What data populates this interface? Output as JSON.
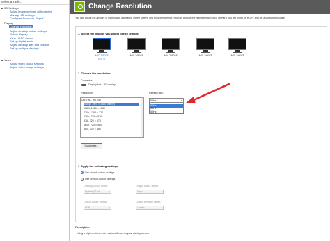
{
  "left_pane": {
    "title": "Select a Task...",
    "groups": [
      {
        "name": "3D Settings",
        "items": [
          "Adjust image settings with preview",
          "Manage 3D settings",
          "Configure Surround, PhysX"
        ]
      },
      {
        "name": "Display",
        "items": [
          "Change resolution",
          "Adjust desktop colour settings",
          "Rotate display",
          "View HDCP status",
          "Set up digital audio",
          "Adjust desktop size and position",
          "Set up multiple displays"
        ]
      },
      {
        "name": "Video",
        "items": [
          "Adjust video colour settings",
          "Adjust video image settings"
        ]
      }
    ],
    "selected_item": "Change resolution"
  },
  "header": {
    "title": "Change Resolution"
  },
  "description": "You can adjust the amount of information appearing on the screen and reduce flickering. You can choose the high definition (HD) format if you are using an HDTV and set a custom resolution.",
  "section1": {
    "title": "1. Select the display you would like to change.",
    "displays": [
      {
        "name": "AOC 2460G5",
        "index": "(1 of 4)",
        "active": true
      },
      {
        "name": "AOC 2460G5",
        "index": "",
        "active": false
      },
      {
        "name": "AOC 2460G5",
        "index": "",
        "active": false
      },
      {
        "name": "AOC 2460G5",
        "index": "",
        "active": false
      },
      {
        "name": "AOC 2460G5",
        "index": "",
        "active": false
      }
    ]
  },
  "section2": {
    "title": "2. Choose the resolution.",
    "connector_label": "Connector:",
    "connector_value": "DisplayPort - PC display",
    "resolution_label": "Resolution:",
    "refresh_label": "Refresh rate:",
    "resolution_category": "Ultra HD, HD, SD",
    "resolutions": [
      "1080p, 1920 × 1080 (native)",
      "1080i, 1920 × 1080",
      "720p, 1280 × 720",
      "576p, 720 × 576",
      "576i, 720 × 576",
      "480p, 720 × 480",
      "480i, 720 × 480"
    ],
    "selected_resolution_index": 0,
    "refresh_selected": "60Hz",
    "refresh_options": [
      "60Hz",
      "59Hz",
      "50Hz"
    ],
    "customize_label": "Customise..."
  },
  "section3": {
    "title": "3. Apply the following settings.",
    "radio_default": "Use default colour settings",
    "radio_nvidia": "Use NVIDIA colour settings",
    "desktop_colour_depth_label": "Desktop colour depth:",
    "desktop_colour_depth_value": "Highest (32-bit)",
    "output_colour_depth_label": "Output colour depth:",
    "output_colour_depth_value": "8 bpc",
    "output_colour_format_label": "Output colour format:",
    "output_colour_format_value": "RGB",
    "output_dynamic_range_label": "Output dynamic range:",
    "output_dynamic_range_value": "Limited"
  },
  "footer": {
    "description_title": "Description:",
    "typical_usage": "Using a higher refresh rate reduces flicker on your display screen."
  }
}
